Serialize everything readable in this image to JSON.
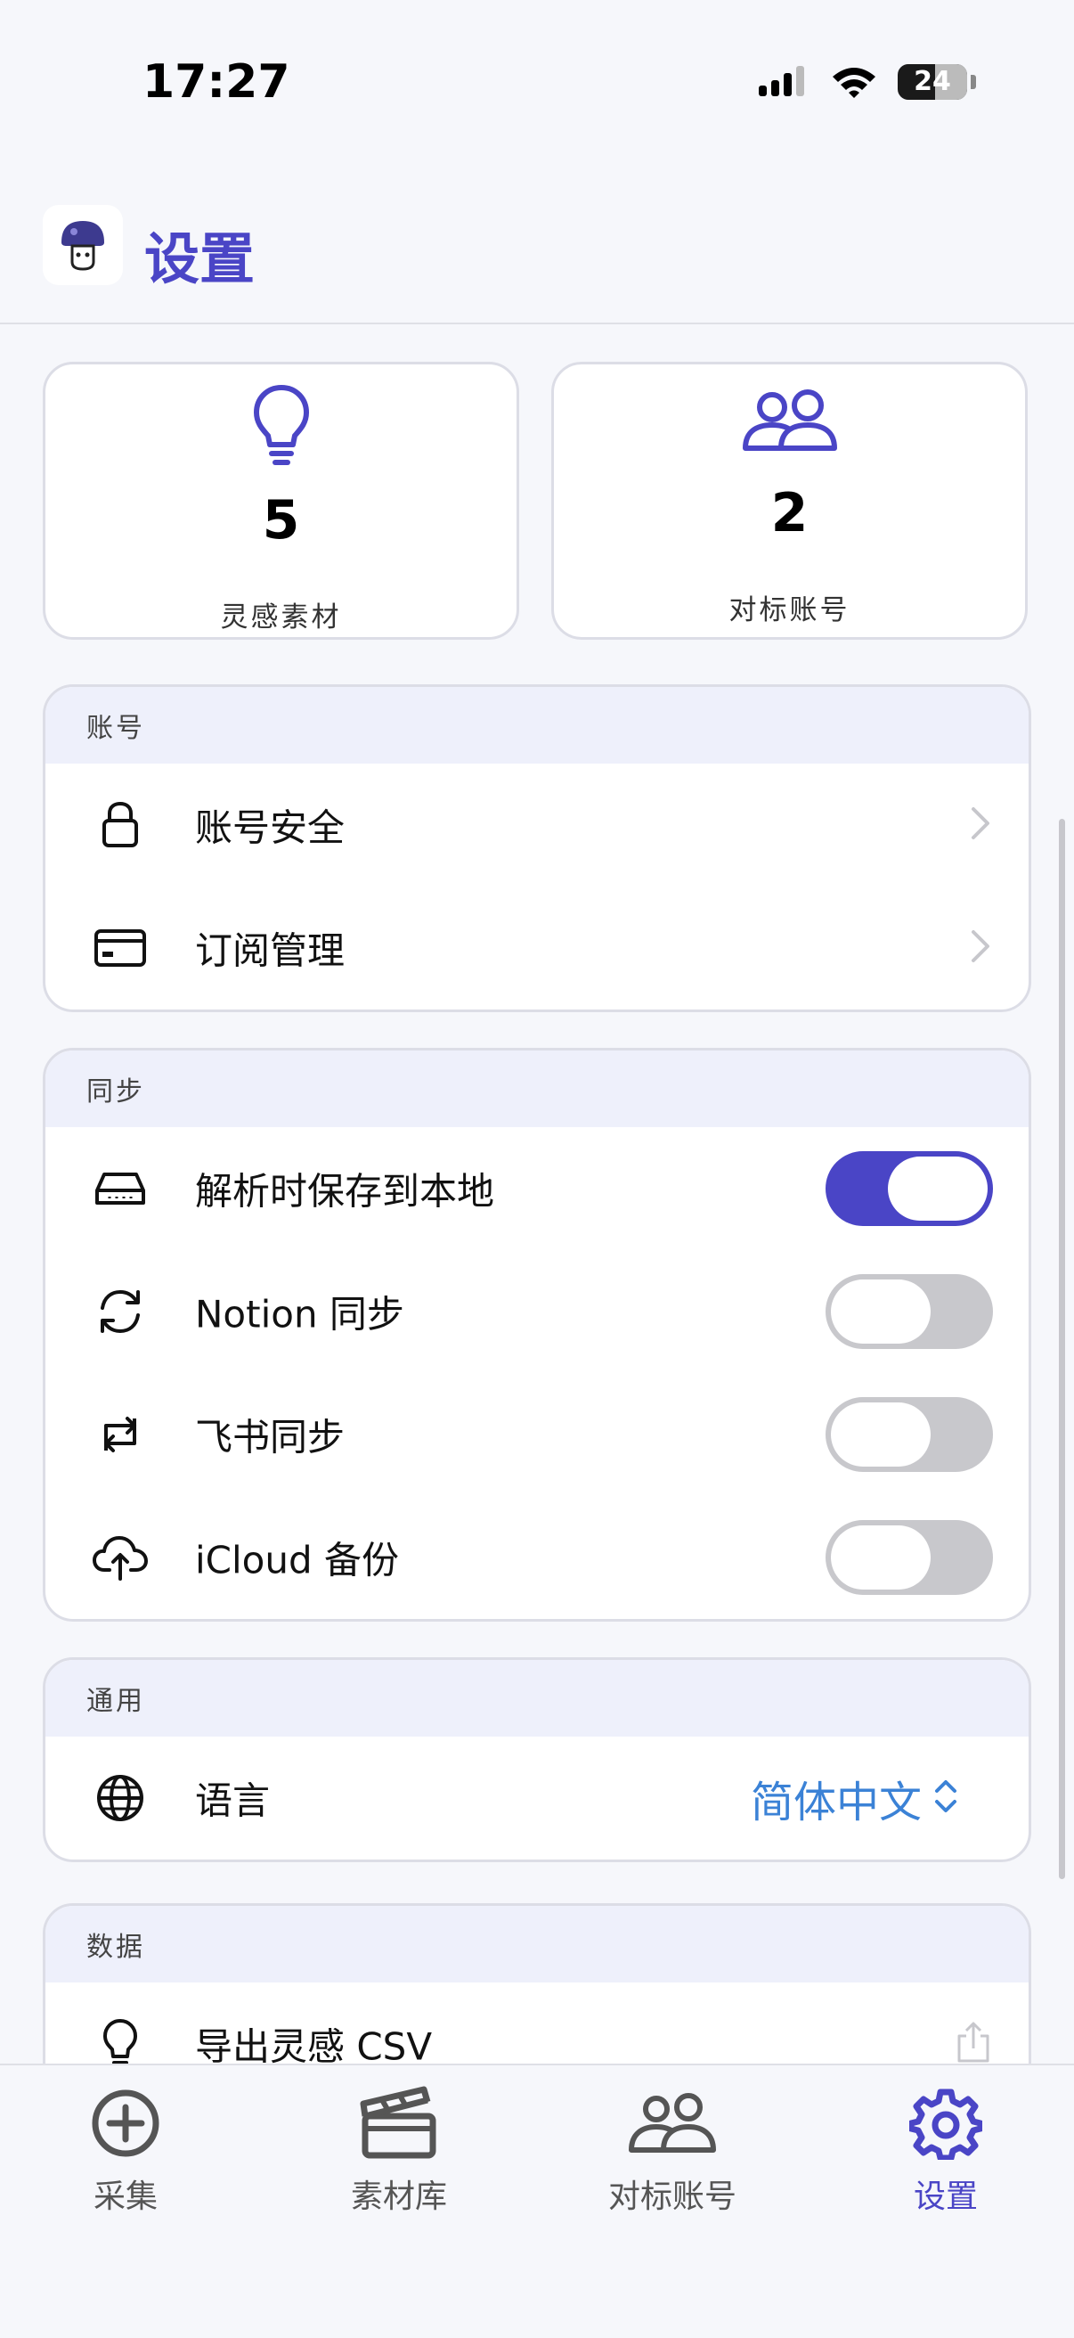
{
  "status_bar": {
    "time": "17:27",
    "battery": "24"
  },
  "header": {
    "title": "设置",
    "logo_icon": "mushroom-avatar-icon"
  },
  "stats": [
    {
      "icon": "lightbulb-icon",
      "value": "5",
      "label": "灵感素材"
    },
    {
      "icon": "people-icon",
      "value": "2",
      "label": "对标账号"
    }
  ],
  "sections": {
    "account": {
      "title": "账号",
      "items": [
        {
          "label": "账号安全",
          "icon": "lock-icon"
        },
        {
          "label": "订阅管理",
          "icon": "credit-card-icon"
        }
      ]
    },
    "sync": {
      "title": "同步",
      "items": [
        {
          "label": "解析时保存到本地",
          "icon": "drive-icon",
          "enabled": true
        },
        {
          "label": "Notion 同步",
          "icon": "sync-icon",
          "enabled": false
        },
        {
          "label": "飞书同步",
          "icon": "repeat-icon",
          "enabled": false
        },
        {
          "label": "iCloud 备份",
          "icon": "cloud-upload-icon",
          "enabled": false
        }
      ]
    },
    "general": {
      "title": "通用",
      "items": [
        {
          "label": "语言",
          "icon": "globe-icon",
          "value": "简体中文"
        }
      ]
    },
    "data": {
      "title": "数据",
      "items": [
        {
          "label": "导出灵感 CSV",
          "icon": "lightbulb-icon"
        }
      ]
    }
  },
  "tabbar": [
    {
      "label": "采集",
      "icon": "plus-circle-icon",
      "active": false
    },
    {
      "label": "素材库",
      "icon": "clapperboard-icon",
      "active": false
    },
    {
      "label": "对标账号",
      "icon": "people-icon",
      "active": false
    },
    {
      "label": "设置",
      "icon": "gear-icon",
      "active": true
    }
  ],
  "colors": {
    "accent": "#4a45c6",
    "link": "#3b82d6",
    "toggle_off": "#c8c8cc",
    "section_header": "#eef0fb"
  }
}
